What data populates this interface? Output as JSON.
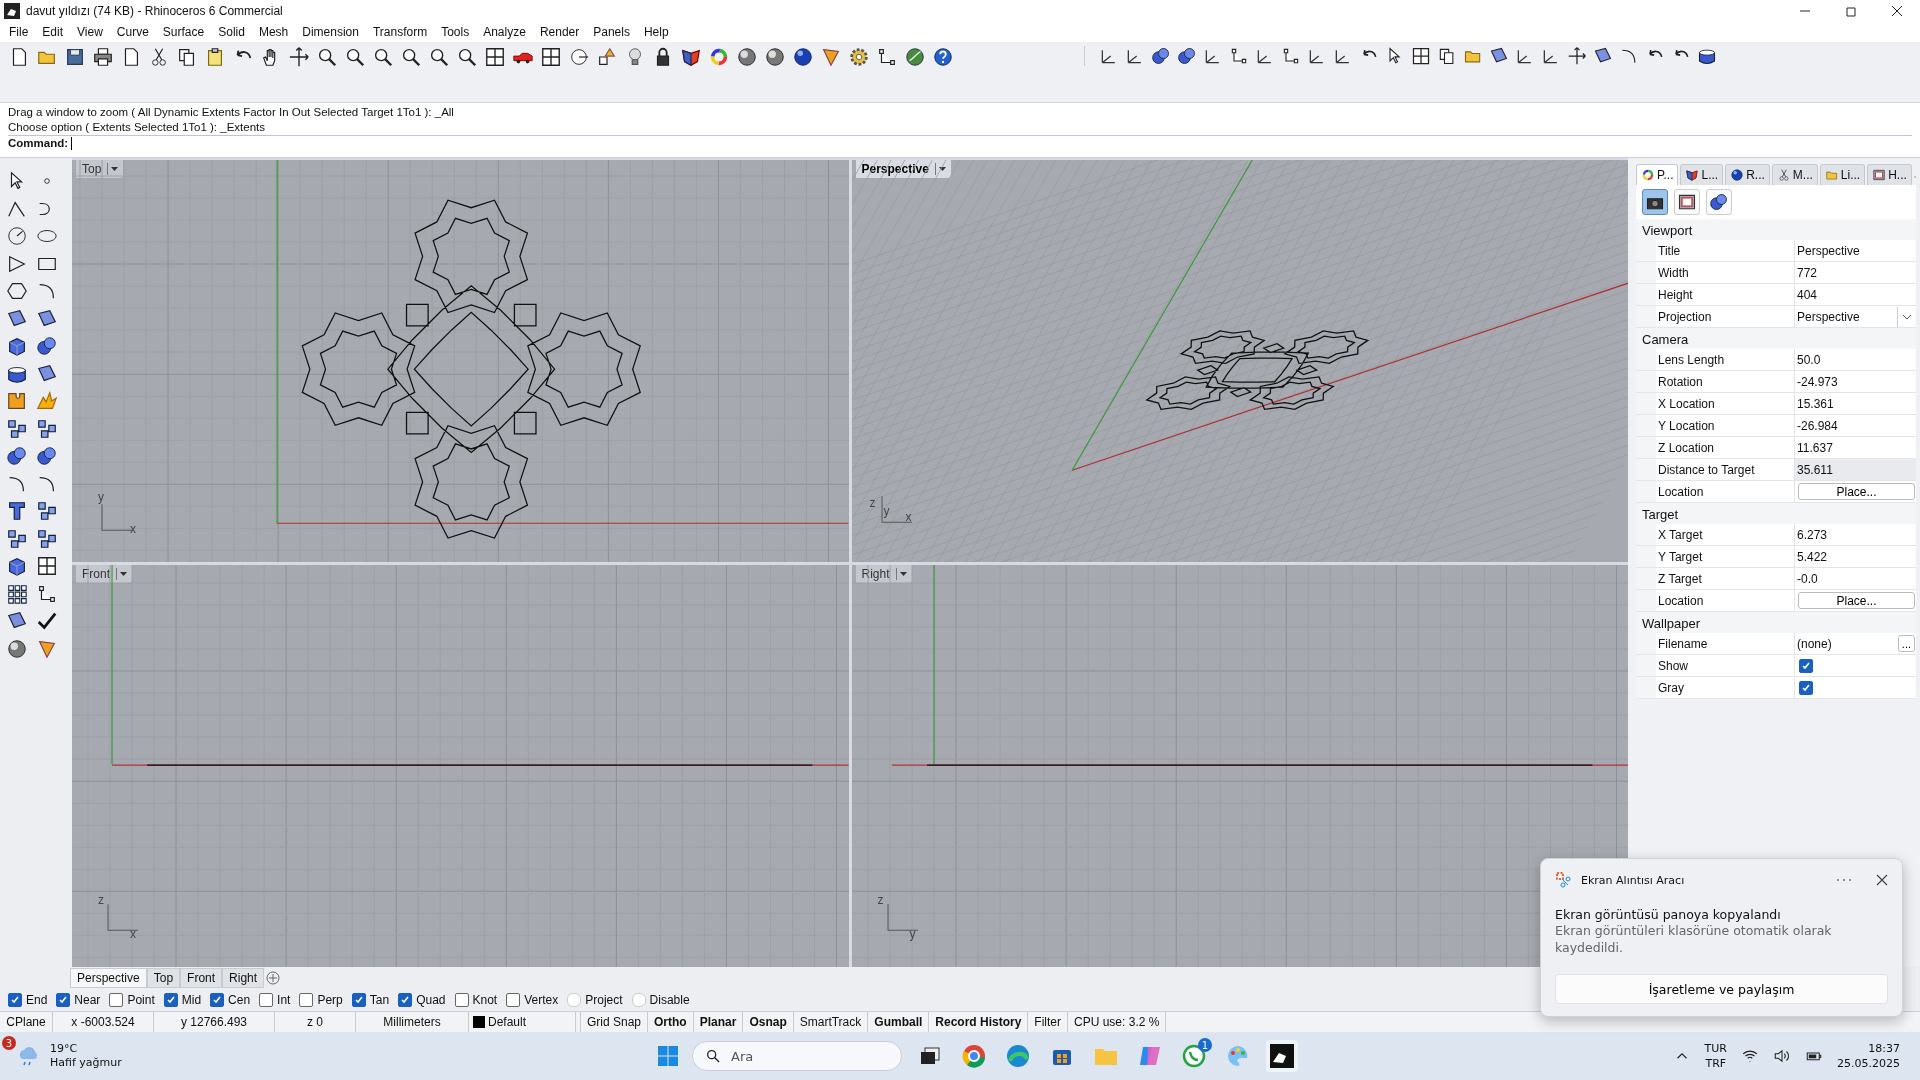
{
  "window": {
    "title": "davut yıldızı (74 KB) - Rhinoceros 6 Commercial"
  },
  "menu": [
    "File",
    "Edit",
    "View",
    "Curve",
    "Surface",
    "Solid",
    "Mesh",
    "Dimension",
    "Transform",
    "Tools",
    "Analyze",
    "Render",
    "Panels",
    "Help"
  ],
  "command": {
    "history": [
      "Drag a window to zoom ( All  Dynamic  Extents  Factor  In  Out  Selected  Target  1To1 ): _All",
      "Choose option ( Extents  Selected  1To1 ): _Extents"
    ],
    "prompt": "Command:"
  },
  "viewports": [
    {
      "title": "Top",
      "kind": "top",
      "selected": false,
      "axes": [
        "y",
        "x"
      ]
    },
    {
      "title": "Perspective",
      "kind": "perspective",
      "selected": true,
      "axes": [
        "z",
        "y",
        "x"
      ]
    },
    {
      "title": "Front",
      "kind": "front",
      "selected": false,
      "axes": [
        "z",
        "x"
      ]
    },
    {
      "title": "Right",
      "kind": "right",
      "selected": false,
      "axes": [
        "z",
        "y"
      ]
    }
  ],
  "viewport_tabs": [
    {
      "label": "Perspective",
      "selected": true
    },
    {
      "label": "Top",
      "selected": false
    },
    {
      "label": "Front",
      "selected": false
    },
    {
      "label": "Right",
      "selected": false
    }
  ],
  "panel": {
    "tabs": [
      {
        "label": "P...",
        "selected": true
      },
      {
        "label": "L...",
        "selected": false
      },
      {
        "label": "R...",
        "selected": false
      },
      {
        "label": "M...",
        "selected": false
      },
      {
        "label": "Li...",
        "selected": false
      },
      {
        "label": "H...",
        "selected": false
      }
    ],
    "views": [
      {
        "kind": "camera",
        "selected": true
      },
      {
        "kind": "frame",
        "selected": false
      },
      {
        "kind": "target",
        "selected": false
      }
    ],
    "sections": [
      {
        "title": "Viewport",
        "rows": [
          {
            "label": "Title",
            "kind": "text",
            "value": "Perspective"
          },
          {
            "label": "Width",
            "kind": "text",
            "value": "772"
          },
          {
            "label": "Height",
            "kind": "text",
            "value": "404"
          },
          {
            "label": "Projection",
            "kind": "dropdown",
            "value": "Perspective"
          }
        ]
      },
      {
        "title": "Camera",
        "rows": [
          {
            "label": "Lens Length",
            "kind": "text",
            "value": "50.0"
          },
          {
            "label": "Rotation",
            "kind": "text",
            "value": "-24.973"
          },
          {
            "label": "X Location",
            "kind": "text",
            "value": "15.361"
          },
          {
            "label": "Y Location",
            "kind": "text",
            "value": "-26.984"
          },
          {
            "label": "Z Location",
            "kind": "text",
            "value": "11.637"
          },
          {
            "label": "Distance to Target",
            "kind": "readonly",
            "value": "35.611"
          },
          {
            "label": "Location",
            "kind": "button",
            "value": "Place..."
          }
        ]
      },
      {
        "title": "Target",
        "rows": [
          {
            "label": "X Target",
            "kind": "text",
            "value": "6.273"
          },
          {
            "label": "Y Target",
            "kind": "text",
            "value": "5.422"
          },
          {
            "label": "Z Target",
            "kind": "text",
            "value": "-0.0"
          },
          {
            "label": "Location",
            "kind": "button",
            "value": "Place..."
          }
        ]
      },
      {
        "title": "Wallpaper",
        "rows": [
          {
            "label": "Filename",
            "kind": "file",
            "value": "(none)",
            "button": "..."
          },
          {
            "label": "Show",
            "kind": "checkbox",
            "checked": true
          },
          {
            "label": "Gray",
            "kind": "checkbox",
            "checked": true
          }
        ]
      }
    ]
  },
  "osnaps": [
    {
      "label": "End",
      "checked": true,
      "disabled": false
    },
    {
      "label": "Near",
      "checked": true,
      "disabled": false
    },
    {
      "label": "Point",
      "checked": false,
      "disabled": false
    },
    {
      "label": "Mid",
      "checked": true,
      "disabled": false
    },
    {
      "label": "Cen",
      "checked": true,
      "disabled": false
    },
    {
      "label": "Int",
      "checked": false,
      "disabled": false
    },
    {
      "label": "Perp",
      "checked": false,
      "disabled": false
    },
    {
      "label": "Tan",
      "checked": true,
      "disabled": false
    },
    {
      "label": "Quad",
      "checked": true,
      "disabled": false
    },
    {
      "label": "Knot",
      "checked": false,
      "disabled": false
    },
    {
      "label": "Vertex",
      "checked": false,
      "disabled": false
    },
    {
      "label": "Project",
      "checked": false,
      "disabled": true
    },
    {
      "label": "Disable",
      "checked": false,
      "disabled": true
    }
  ],
  "status_bar": {
    "cells": [
      "CPlane",
      "x -6003.524",
      "y 12766.493",
      "z 0",
      "Millimeters"
    ],
    "layer": {
      "name": "Default",
      "color": "#000000"
    },
    "toggles": [
      {
        "label": "Grid Snap",
        "on": false
      },
      {
        "label": "Ortho",
        "on": true
      },
      {
        "label": "Planar",
        "on": true
      },
      {
        "label": "Osnap",
        "on": true
      },
      {
        "label": "SmartTrack",
        "on": false
      },
      {
        "label": "Gumball",
        "on": true
      },
      {
        "label": "Record History",
        "on": true
      },
      {
        "label": "Filter",
        "on": false
      }
    ],
    "cpu": "CPU use: 3.2 %"
  },
  "notification": {
    "app": "Ekran Alıntısı Aracı",
    "title": "Ekran görüntüsü panoya kopyalandı",
    "body": "Ekran görüntüleri klasörüne otomatik olarak kaydedildi.",
    "button": "İşaretleme ve paylaşım"
  },
  "taskbar": {
    "weather": {
      "badge": "3",
      "temperature": "19°C",
      "condition": "Hafif yağmur"
    },
    "search": {
      "placeholder": "Ara"
    },
    "chat_badge": "1",
    "tray": {
      "language": "TUR",
      "layout": "TRF",
      "time": "18:37",
      "date": "25.05.2025"
    }
  }
}
